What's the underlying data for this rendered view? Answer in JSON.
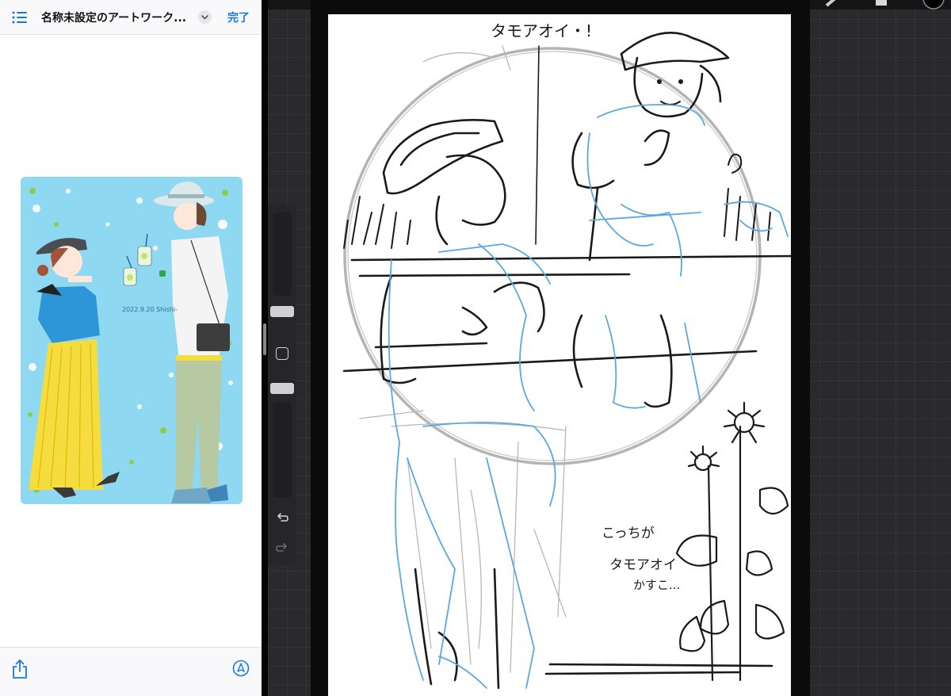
{
  "files_pane": {
    "document_title": "名称未設定のアートワーク...",
    "done_label": "完了",
    "artwork": {
      "date_signature": "2022.9.20 Shishi-",
      "background_color": "#8fd8f2"
    }
  },
  "procreate": {
    "canvas_annotations": {
      "top_note": "タモアオイ・!",
      "bottom_note_line1": "こっちが",
      "bottom_note_line2": "タモアオイ",
      "bottom_note_line3": "かすこ..."
    },
    "sketch_colors": {
      "black_line": "#1a1a1a",
      "blue_line": "#5aa8dc",
      "gray_line": "#a8a8a8"
    }
  },
  "colors": {
    "accent": "#1577e8",
    "canvas_bg": "#2a2a2c"
  }
}
